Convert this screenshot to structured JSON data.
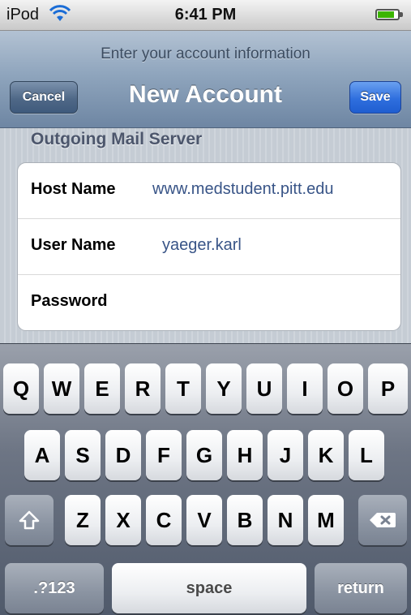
{
  "status_bar": {
    "carrier": "iPod",
    "time": "6:41 PM"
  },
  "nav": {
    "prompt": "Enter your account information",
    "title": "New Account",
    "cancel_label": "Cancel",
    "save_label": "Save",
    "save_color": "#2f6fde"
  },
  "section": {
    "header": "Outgoing Mail Server",
    "fields": [
      {
        "label": "Host Name",
        "value": "www.medstudent.pitt.edu"
      },
      {
        "label": "User Name",
        "value": "yaeger.karl"
      },
      {
        "label": "Password",
        "value": ""
      }
    ]
  },
  "keyboard": {
    "row1": [
      "Q",
      "W",
      "E",
      "R",
      "T",
      "Y",
      "U",
      "I",
      "O",
      "P"
    ],
    "row2": [
      "A",
      "S",
      "D",
      "F",
      "G",
      "H",
      "J",
      "K",
      "L"
    ],
    "row3": [
      "Z",
      "X",
      "C",
      "V",
      "B",
      "N",
      "M"
    ],
    "shift_icon": "shift-arrow-icon",
    "delete_icon": "delete-backspace-icon",
    "numbers_label": ".?123",
    "space_label": "space",
    "return_label": "return"
  }
}
